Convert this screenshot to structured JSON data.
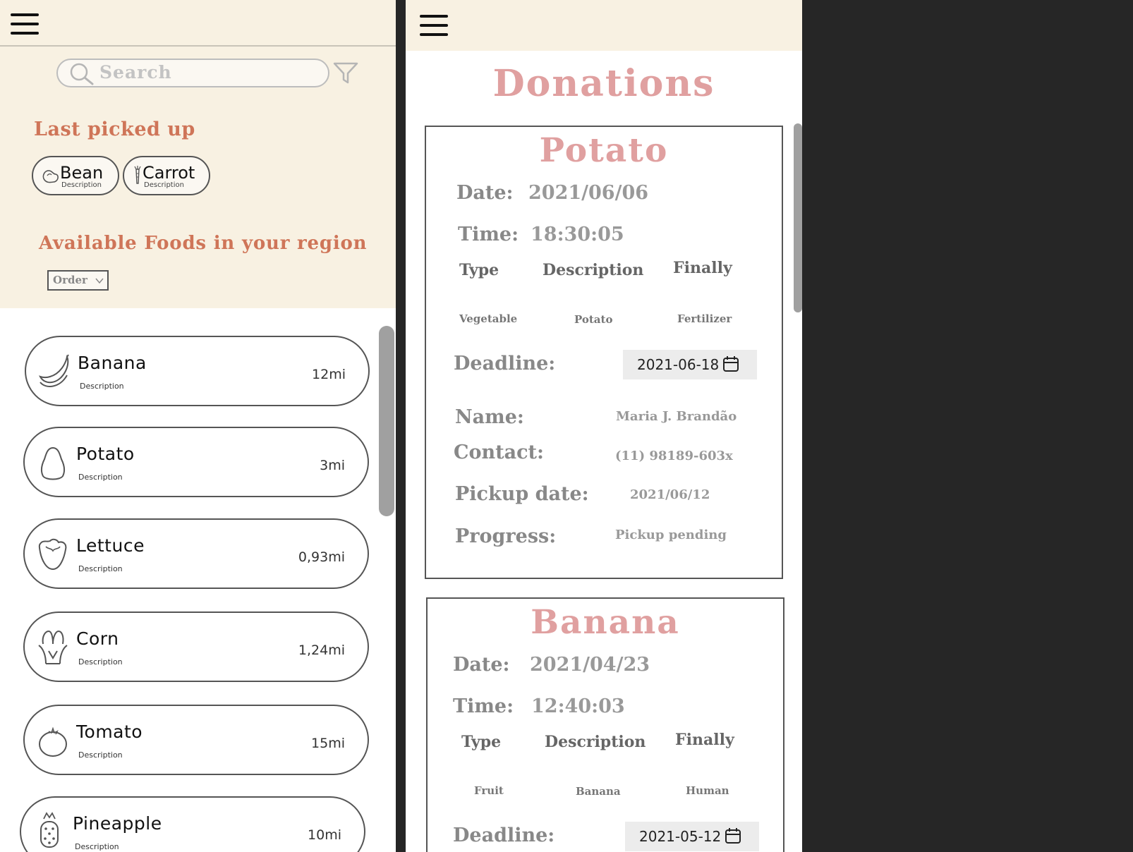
{
  "left_panel": {
    "search": {
      "placeholder": "Search"
    },
    "last_picked": {
      "title": "Last picked up",
      "items": [
        {
          "label": "Bean",
          "desc": "Description",
          "icon": "bean-icon"
        },
        {
          "label": "Carrot",
          "desc": "Description",
          "icon": "carrot-icon"
        }
      ]
    },
    "available": {
      "title": "Available Foods in your region",
      "order_label": "Order"
    },
    "foods": [
      {
        "name": "Banana",
        "desc": "Description",
        "dist": "12mi",
        "icon": "banana-icon"
      },
      {
        "name": "Potato",
        "desc": "Description",
        "dist": "3mi",
        "icon": "potato-icon"
      },
      {
        "name": "Lettuce",
        "desc": "Description",
        "dist": "0,93mi",
        "icon": "lettuce-icon"
      },
      {
        "name": "Corn",
        "desc": "Description",
        "dist": "1,24mi",
        "icon": "corn-icon"
      },
      {
        "name": "Tomato",
        "desc": "Description",
        "dist": "15mi",
        "icon": "tomato-icon"
      },
      {
        "name": "Pineapple",
        "desc": "Description",
        "dist": "10mi",
        "icon": "pineapple-icon"
      }
    ]
  },
  "right_panel": {
    "title": "Donations",
    "labels": {
      "date": "Date:",
      "time": "Time:",
      "type": "Type",
      "description": "Description",
      "finally": "Finally",
      "deadline": "Deadline:",
      "name": "Name:",
      "contact": "Contact:",
      "pickup_date": "Pickup date:",
      "progress": "Progress:"
    },
    "cards": [
      {
        "title": "Potato",
        "date": "2021/06/06",
        "time": "18:30:05",
        "type": "Vegetable",
        "description": "Potato",
        "finally": "Fertilizer",
        "deadline": "2021-06-18",
        "name": "Maria J. Brandão",
        "contact": "(11) 98189-603x",
        "pickup_date": "2021/06/12",
        "progress": "Pickup pending"
      },
      {
        "title": "Banana",
        "date": "2021/04/23",
        "time": "12:40:03",
        "type": "Fruit",
        "description": "Banana",
        "finally": "Human",
        "deadline": "2021-05-12"
      }
    ]
  },
  "colors": {
    "cream": "#f8f1e2",
    "accent_orange": "#cf7558",
    "accent_pink": "#e0a0a0",
    "dark_background": "#262626"
  }
}
